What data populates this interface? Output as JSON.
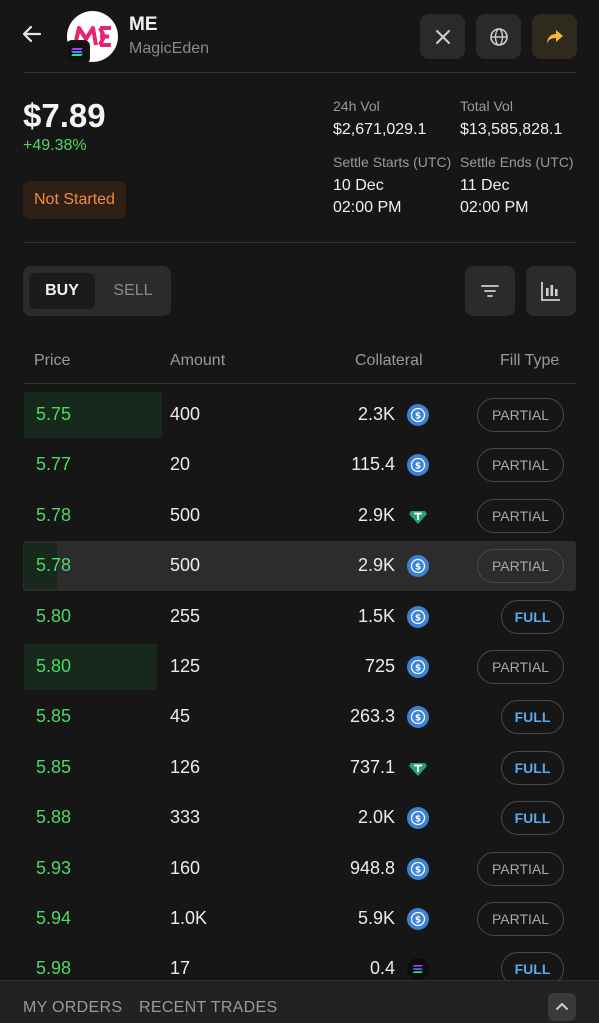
{
  "header": {
    "title": "ME",
    "subtitle": "MagicEden",
    "logo_text": "ME",
    "brand_color": "#e42575"
  },
  "stats": {
    "price": "$7.89",
    "change": "+49.38%",
    "status": "Not Started",
    "vol24h_label": "24h Vol",
    "vol24h_value": "$2,671,029.1",
    "total_vol_label": "Total Vol",
    "total_vol_value": "$13,585,828.1",
    "settle_start_label": "Settle Starts (UTC)",
    "settle_start_date": "10 Dec",
    "settle_start_time": "02:00 PM",
    "settle_end_label": "Settle Ends (UTC)",
    "settle_end_date": "11 Dec",
    "settle_end_time": "02:00 PM"
  },
  "controls": {
    "buy_label": "BUY",
    "sell_label": "SELL",
    "active": "BUY"
  },
  "table": {
    "headers": {
      "price": "Price",
      "amount": "Amount",
      "collateral": "Collateral",
      "fill_type": "Fill Type"
    },
    "rows": [
      {
        "price": "5.75",
        "amount": "400",
        "collateral": "2.3K",
        "token": "usdc",
        "fill": "PARTIAL",
        "depth": 0.25
      },
      {
        "price": "5.77",
        "amount": "20",
        "collateral": "115.4",
        "token": "usdc",
        "fill": "PARTIAL",
        "depth": 0
      },
      {
        "price": "5.78",
        "amount": "500",
        "collateral": "2.9K",
        "token": "usdt",
        "fill": "PARTIAL",
        "depth": 0
      },
      {
        "price": "5.78",
        "amount": "500",
        "collateral": "2.9K",
        "token": "usdc",
        "fill": "PARTIAL",
        "depth": 0.06,
        "highlighted": true
      },
      {
        "price": "5.80",
        "amount": "255",
        "collateral": "1.5K",
        "token": "usdc",
        "fill": "FULL",
        "depth": 0
      },
      {
        "price": "5.80",
        "amount": "125",
        "collateral": "725",
        "token": "usdc",
        "fill": "PARTIAL",
        "depth": 0.24
      },
      {
        "price": "5.85",
        "amount": "45",
        "collateral": "263.3",
        "token": "usdc",
        "fill": "FULL",
        "depth": 0
      },
      {
        "price": "5.85",
        "amount": "126",
        "collateral": "737.1",
        "token": "usdt",
        "fill": "FULL",
        "depth": 0
      },
      {
        "price": "5.88",
        "amount": "333",
        "collateral": "2.0K",
        "token": "usdc",
        "fill": "FULL",
        "depth": 0
      },
      {
        "price": "5.93",
        "amount": "160",
        "collateral": "948.8",
        "token": "usdc",
        "fill": "PARTIAL",
        "depth": 0
      },
      {
        "price": "5.94",
        "amount": "1.0K",
        "collateral": "5.9K",
        "token": "usdc",
        "fill": "PARTIAL",
        "depth": 0
      },
      {
        "price": "5.98",
        "amount": "17",
        "collateral": "0.4",
        "token": "sol",
        "fill": "FULL",
        "depth": 0
      }
    ]
  },
  "bottom_bar": {
    "my_orders": "MY ORDERS",
    "recent_trades": "RECENT TRADES"
  },
  "colors": {
    "price_green": "#4cd964",
    "status_orange": "#f28c3a",
    "usdc_blue": "#3b82d6",
    "usdt_teal": "#26a17b",
    "full_blue": "#5aa9f0"
  }
}
